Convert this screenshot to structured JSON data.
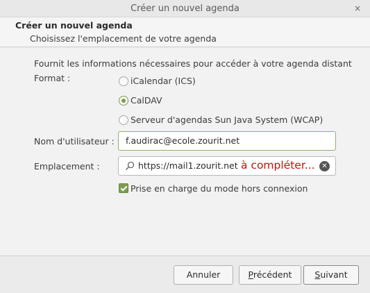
{
  "window": {
    "title": "Créer un nouvel agenda",
    "close_glyph": "×"
  },
  "header": {
    "title": "Créer un nouvel agenda",
    "subtitle": "Choisissez l'emplacement de votre agenda"
  },
  "form": {
    "intro": "Fournit les informations nécessaires pour accéder à votre agenda distant",
    "format_label": "Format :",
    "format_options": [
      {
        "label": "iCalendar (ICS)",
        "selected": false
      },
      {
        "label": "CalDAV",
        "selected": true
      },
      {
        "label": "Serveur d'agendas Sun Java System (WCAP)",
        "selected": false
      }
    ],
    "username_label": "Nom d'utilisateur :",
    "username_value": "f.audirac@ecole.zourit.net",
    "location_label": "Emplacement :",
    "location_value": "https://mail1.zourit.net",
    "location_annotation": "à compléter...",
    "offline_label": "Prise en charge du mode hors connexion",
    "offline_checked": true
  },
  "icons": {
    "search": "search-icon",
    "clear": "clear-icon",
    "clear_glyph": "✕"
  },
  "colors": {
    "accent": "#7c9c4f",
    "annotation": "#d10b0b"
  },
  "buttons": {
    "cancel": "Annuler",
    "previous_pre": "",
    "previous_key": "P",
    "previous_post": "récédent",
    "next_pre": "",
    "next_key": "S",
    "next_post": "uivant"
  }
}
